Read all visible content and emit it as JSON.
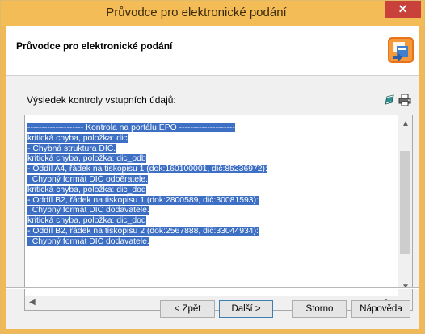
{
  "window": {
    "title": "Průvodce pro elektronické podání",
    "close_glyph": "✕"
  },
  "header": {
    "title": "Průvodce pro elektronické podání",
    "icon": "wizard-icon"
  },
  "section": {
    "label": "Výsledek kontroly vstupních údajů:"
  },
  "toolbar": {
    "icons": [
      "edit-icon",
      "print-icon"
    ]
  },
  "results": {
    "lines": [
      "-------------------- Kontrola na portálu EPO --------------------",
      "kritická chyba, položka: dic",
      "- Chybná struktura DIČ.",
      "kritická chyba, položka: dic_odb",
      "- Oddíl A4, řádek na tiskopisu 1 (dok:160100001, dič:85236972):",
      "  Chybný formát DIČ odběratele.",
      "kritická chyba, položka: dic_dod",
      "- Oddíl B2, řádek na tiskopisu 1 (dok:2800589, dič:30081593):",
      "  Chybný formát DIČ dodavatele.",
      "kritická chyba, položka: dic_dod",
      "- Oddíl B2, řádek na tiskopisu 2 (dok:2567888, dič:33044934):",
      "  Chybný formát DIČ dodavatele."
    ]
  },
  "buttons": {
    "back": "< Zpět",
    "next": "Další >",
    "cancel": "Storno",
    "help": "Nápověda"
  }
}
